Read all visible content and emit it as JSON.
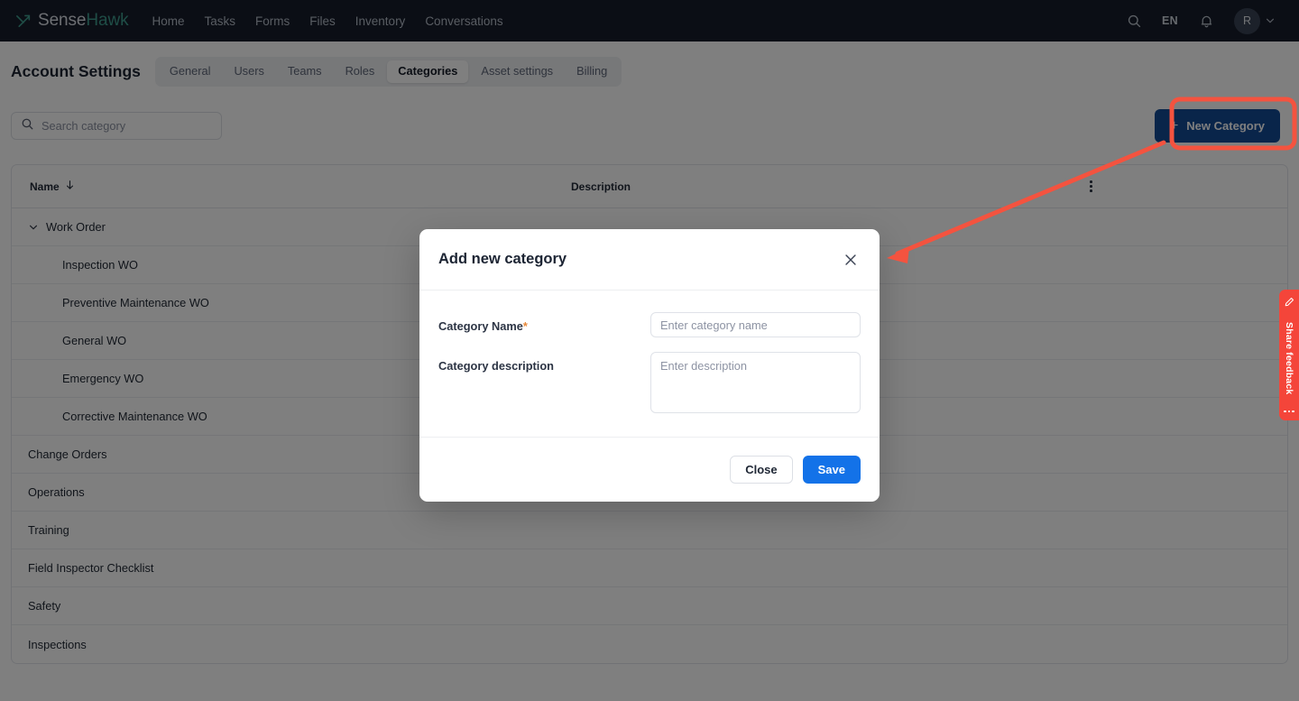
{
  "topbar": {
    "brand": {
      "name_part1": "Sense",
      "name_part2": "Hawk",
      "logo_icon": "sensehawk-arrow-icon"
    },
    "nav": [
      {
        "label": "Home"
      },
      {
        "label": "Tasks"
      },
      {
        "label": "Forms"
      },
      {
        "label": "Files"
      },
      {
        "label": "Inventory"
      },
      {
        "label": "Conversations"
      }
    ],
    "search_icon": "search-icon",
    "language": "EN",
    "notification_icon": "bell-icon",
    "avatar_initial": "R",
    "avatar_chevron_icon": "chevron-down-icon"
  },
  "subheader": {
    "title": "Account Settings",
    "tabs": [
      {
        "label": "General",
        "active": false
      },
      {
        "label": "Users",
        "active": false
      },
      {
        "label": "Teams",
        "active": false
      },
      {
        "label": "Roles",
        "active": false
      },
      {
        "label": "Categories",
        "active": true
      },
      {
        "label": "Asset settings",
        "active": false
      },
      {
        "label": "Billing",
        "active": false
      }
    ]
  },
  "toolbar": {
    "search_placeholder": "Search category",
    "search_value": "",
    "search_icon": "search-icon",
    "new_category_label": "New Category",
    "new_category_icon": "plus-icon",
    "new_category_color": "#134a95"
  },
  "table": {
    "columns": {
      "name": "Name",
      "description": "Description"
    },
    "sort_icon": "arrow-down-icon",
    "options_icon": "kebab-menu-icon",
    "rows": [
      {
        "name": "Work Order",
        "description": "",
        "level": 0,
        "expandable": true,
        "expanded": true
      },
      {
        "name": "Inspection WO",
        "description": "",
        "level": 1,
        "expandable": false,
        "expanded": false
      },
      {
        "name": "Preventive Maintenance WO",
        "description": "",
        "level": 1,
        "expandable": false,
        "expanded": false
      },
      {
        "name": "General WO",
        "description": "",
        "level": 1,
        "expandable": false,
        "expanded": false
      },
      {
        "name": "Emergency WO",
        "description": "",
        "level": 1,
        "expandable": false,
        "expanded": false
      },
      {
        "name": "Corrective Maintenance WO",
        "description": "",
        "level": 1,
        "expandable": false,
        "expanded": false
      },
      {
        "name": "Change Orders",
        "description": "",
        "level": 0,
        "expandable": false,
        "expanded": false
      },
      {
        "name": "Operations",
        "description": "",
        "level": 0,
        "expandable": false,
        "expanded": false
      },
      {
        "name": "Training",
        "description": "",
        "level": 0,
        "expandable": false,
        "expanded": false
      },
      {
        "name": "Field Inspector Checklist",
        "description": "",
        "level": 0,
        "expandable": false,
        "expanded": false
      },
      {
        "name": "Safety",
        "description": "",
        "level": 0,
        "expandable": false,
        "expanded": false
      },
      {
        "name": "Inspections",
        "description": "",
        "level": 0,
        "expandable": false,
        "expanded": false
      }
    ]
  },
  "modal": {
    "title": "Add new category",
    "close_icon": "close-icon",
    "fields": [
      {
        "label": "Category Name",
        "required": true,
        "required_mark": "*",
        "placeholder": "Enter category name",
        "value": "",
        "type": "text"
      },
      {
        "label": "Category description",
        "required": false,
        "required_mark": "",
        "placeholder": "Enter description",
        "value": "",
        "type": "textarea"
      }
    ],
    "close_label": "Close",
    "save_label": "Save",
    "save_color": "#1372e8"
  },
  "feedback_rail": {
    "label": "Share feedback",
    "pencil_icon": "pencil-icon",
    "dots_icon": "drag-dots-icon",
    "color": "#f4453a"
  },
  "annotations": {
    "highlight_color": "#f4533f",
    "highlight_target": "new-category-button",
    "arrow_from": "new-category-button",
    "arrow_to": "add-new-category-modal"
  }
}
